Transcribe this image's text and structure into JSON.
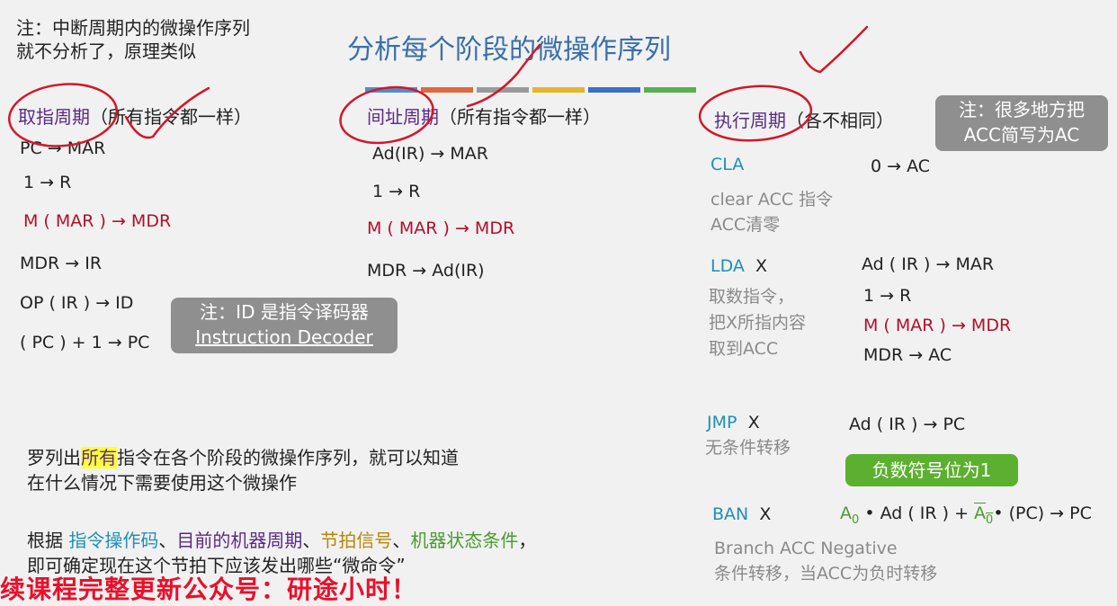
{
  "top_note": [
    "注：中断周期内的微操作序列",
    "就不分析了，原理类似"
  ],
  "title": "分析每个阶段的微操作序列",
  "title_bar_colors": [
    "#4d8ed1",
    "#e06a3b",
    "#9a9a9a",
    "#e3b62c",
    "#3c6fc9",
    "#5ab04e"
  ],
  "fetch": {
    "heading": "取指周期",
    "note": "（所有指令都一样）",
    "steps": [
      "PC → MAR",
      "1 → R",
      "M ( MAR ) → MDR",
      "MDR → IR",
      "OP ( IR ) → ID",
      "( PC ) + 1 → PC"
    ]
  },
  "id_callout": [
    "注：ID 是指令译码器",
    "Instruction Decoder"
  ],
  "indirect": {
    "heading": "间址周期",
    "note": "（所有指令都一样）",
    "steps": [
      "Ad(IR) → MAR",
      "1 → R",
      "M ( MAR ) → MDR",
      "MDR → Ad(IR)"
    ]
  },
  "execute": {
    "heading": "执行周期",
    "note": "（各不相同）",
    "callout": [
      "注：很多地方把",
      "ACC简写为AC"
    ],
    "cla": {
      "name": "CLA",
      "desc": [
        "clear ACC 指令",
        "ACC清零"
      ],
      "ops": [
        "0 → AC"
      ]
    },
    "lda": {
      "name": "LDA",
      "arg": "X",
      "desc": [
        "取数指令，",
        "把X所指内容",
        "取到ACC"
      ],
      "ops": [
        "Ad ( IR ) → MAR",
        "1 → R",
        "M ( MAR ) → MDR",
        "MDR → AC"
      ]
    },
    "jmp": {
      "name": "JMP",
      "arg": "X",
      "desc": [
        "无条件转移"
      ],
      "ops": [
        "Ad ( IR ) → PC"
      ]
    },
    "ban": {
      "name": "BAN",
      "arg": "X",
      "callout": "负数符号位为1",
      "op_a0": "A",
      "op_sub": "0",
      "op_mid": "• Ad ( IR ) + ",
      "op_end": "• (PC) → PC",
      "desc": [
        "Branch ACC Negative",
        "条件转移，当ACC为负时转移"
      ]
    }
  },
  "summary": {
    "line1_pre": "罗列出",
    "line1_hl": "所有",
    "line1_post": "指令在各个阶段的微操作序列，就可以知道",
    "line2": "在什么情况下需要使用这个微操作",
    "line3_pre": "根据 ",
    "k1": "指令操作码",
    "sep1": "、",
    "k2": "目前的机器周期",
    "sep2": "、",
    "k3": "节拍信号",
    "sep3": "、",
    "k4": "机器状态条件",
    "sep4": "，",
    "line4": "即可确定现在这个节拍下应该发出哪些“微命令”"
  },
  "banner": "续课程完整更新公众号：研途小时！"
}
